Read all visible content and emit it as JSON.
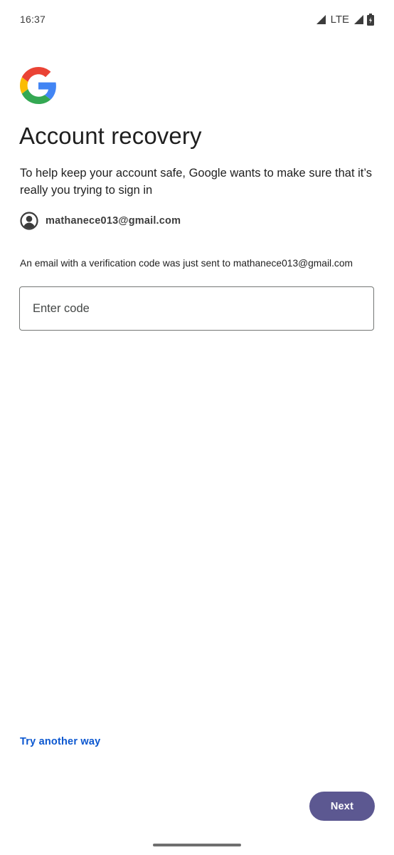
{
  "status_bar": {
    "time": "16:37",
    "network_label": "LTE",
    "icons": [
      "signal-icon",
      "signal-icon",
      "battery-icon"
    ]
  },
  "header": {
    "logo_icon": "google-g-icon",
    "title": "Account recovery"
  },
  "intro": {
    "text": "To help keep your account safe, Google wants to make sure that it’s really you trying to sign in"
  },
  "account": {
    "avatar_icon": "account-circle-icon",
    "email": "mathanece013@gmail.com"
  },
  "verification": {
    "message": "An email with a verification code was just sent to mathanece013@gmail.com",
    "code_input_value": "",
    "code_input_placeholder": "Enter code"
  },
  "actions": {
    "try_another_way": "Try another way",
    "next": "Next"
  },
  "colors": {
    "link": "#0b57d0",
    "primary_button": "#5c5891",
    "field_border": "#747775",
    "text": "#1f1f1f"
  }
}
